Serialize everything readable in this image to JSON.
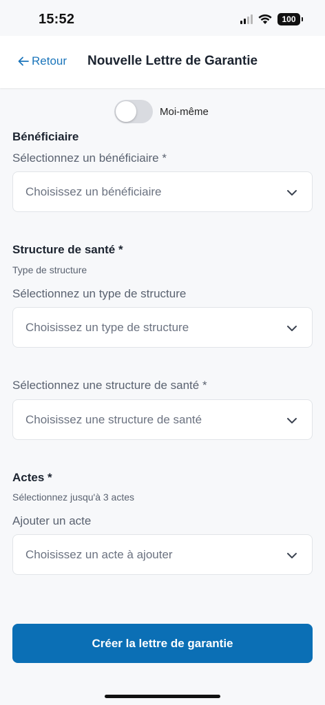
{
  "status_bar": {
    "time": "15:52",
    "battery": "100"
  },
  "header": {
    "back_label": "Retour",
    "title": "Nouvelle Lettre de Garantie"
  },
  "self_toggle": {
    "label": "Moi-même",
    "checked": false
  },
  "beneficiary": {
    "section_title": "Bénéficiaire",
    "field_label": "Sélectionnez un bénéficiaire *",
    "placeholder": "Choisissez un bénéficiaire"
  },
  "health_structure": {
    "section_title": "Structure de santé *",
    "helper": "Type de structure",
    "type_label": "Sélectionnez un type de structure",
    "type_placeholder": "Choisissez un type de structure",
    "structure_label": "Sélectionnez une structure de santé *",
    "structure_placeholder": "Choisissez une structure de santé"
  },
  "acts": {
    "section_title": "Actes *",
    "helper": "Sélectionnez jusqu'à 3 actes",
    "field_label": "Ajouter un acte",
    "placeholder": "Choisissez un acte à ajouter"
  },
  "submit_label": "Créer la lettre de garantie",
  "colors": {
    "accent": "#0b6fb5",
    "link": "#1b75bb",
    "background": "#f7f8fa"
  },
  "icons": {
    "back": "arrow-left-icon",
    "chevron": "chevron-down-icon",
    "signal": "cellular-signal-icon",
    "wifi": "wifi-icon",
    "battery": "battery-icon"
  }
}
